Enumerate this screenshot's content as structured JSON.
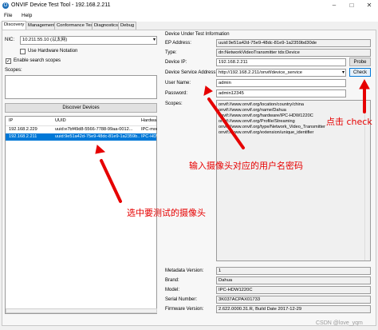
{
  "window": {
    "title": "ONVIF Device Test Tool - 192.168.2.211",
    "menu": [
      "File",
      "Help"
    ],
    "controls": [
      "–",
      "□",
      "✕"
    ]
  },
  "tabs": [
    "Discovery",
    "Management",
    "Conformance Test",
    "Diagnostics",
    "Debug"
  ],
  "left": {
    "nic_label": "NIC:",
    "nic_value": "10.211.55.10 (以太网)",
    "use_hardware_notation": "Use Hardware Notation",
    "enable_search_scopes": "Enable search scopes",
    "scopes_label": "Scopes:",
    "discover_button": "Discover Devices",
    "table": {
      "columns": [
        "IP",
        "UUID",
        "Hardwa"
      ],
      "rows": [
        [
          "192.168.2.229",
          "uuid:e7bf49d8-5566-7788-99aa-0012...",
          "IPC-mod"
        ],
        [
          "192.168.2.211",
          "uuid:9e51a42d-75e9-48dc-81e9-1a2359b...",
          "IPC-HDW"
        ]
      ]
    }
  },
  "right": {
    "group_title": "Device Under Test Information",
    "ep_address_label": "EP Address:",
    "ep_address_value": "uuid:9e51a42d-75e9-48dc-81e9-1a2359bd30de",
    "type_label": "Type:",
    "type_value": "dn:NetworkVideoTransmitter tds:Device",
    "device_ip_label": "Device IP:",
    "device_ip_value": "192.168.2.211",
    "probe_button": "Probe",
    "service_address_label": "Device Service Address:",
    "service_address_value": "http://192.168.2.211/onvif/device_service",
    "check_button": "Check",
    "user_name_label": "User Name:",
    "user_name_value": "admin",
    "password_label": "Password:",
    "password_value": "admin12345",
    "scopes_label": "Scopes:",
    "scopes": [
      "onvif://www.onvif.org/location/country/china",
      "onvif://www.onvif.org/name/Dahua",
      "onvif://www.onvif.org/hardware/IPC-HDW1220C",
      "onvif://www.onvif.org/Profile/Streaming",
      "onvif://www.onvif.org/type/Network_Video_Transmitter",
      "onvif://www.onvif.org/extension/unique_identifier"
    ],
    "metadata_version_label": "Metadata Version:",
    "metadata_version_value": "1",
    "brand_label": "Brand:",
    "brand_value": "Dahua",
    "model_label": "Model:",
    "model_value": "IPC-HDW1220C",
    "serial_label": "Serial Number:",
    "serial_value": "3K037ACPAX01733",
    "firmware_label": "Firmware Version:",
    "firmware_value": "2.622.0000.31.R, Build Date 2017-12-29"
  },
  "annotations": {
    "click_check": "点击 check",
    "enter_credentials": "输入摄像头对应的用户名密码",
    "select_camera": "选中要测试的摄像头",
    "color": "#e60000"
  },
  "watermark": "CSDN @love_yqm"
}
